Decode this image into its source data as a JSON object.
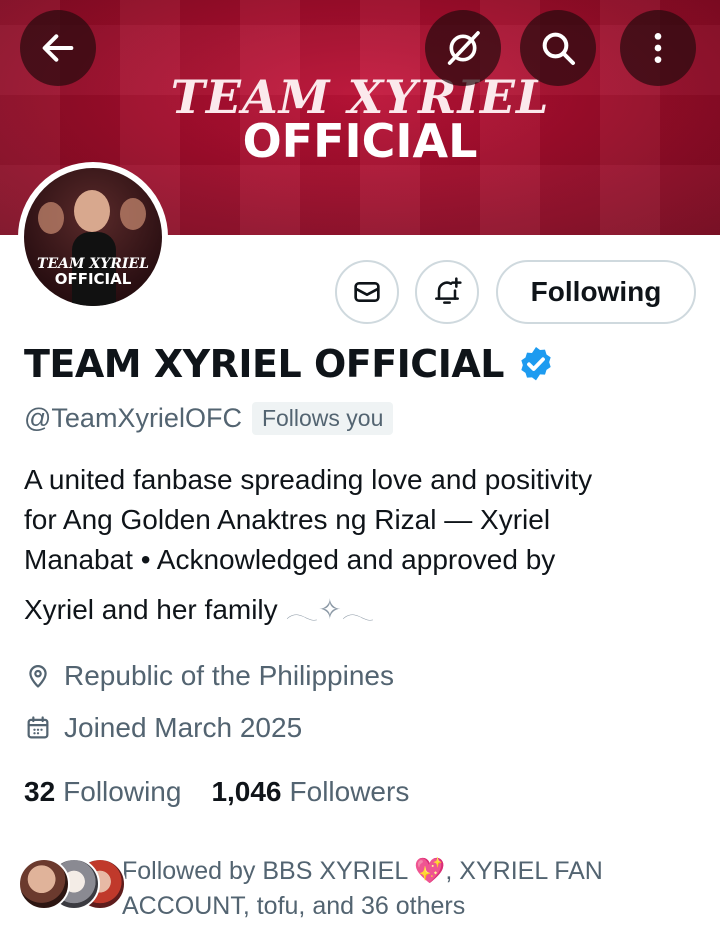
{
  "banner": {
    "title": "TEAM XYRIEL",
    "subtitle": "OFFICIAL"
  },
  "header_buttons": {
    "back_icon": "arrow-left-icon",
    "grok_icon": "grok-icon",
    "search_icon": "search-icon",
    "more_icon": "more-vertical-icon"
  },
  "avatar": {
    "line1": "TEAM XYRIEL",
    "line2": "OFFICIAL"
  },
  "actions": {
    "message_icon": "mail-icon",
    "notify_icon": "bell-plus-icon",
    "following_label": "Following"
  },
  "profile": {
    "display_name": "TEAM XYRIEL OFFICIAL",
    "handle": "@TeamXyrielOFC",
    "follows_you": "Follows you",
    "bio_line1": "A united fanbase spreading love and positivity",
    "bio_line2": "for Ang Golden Anaktres ng Rizal — Xyriel",
    "bio_line3": "Manabat  • Acknowledged and approved by",
    "bio_line4": "Xyriel and her family",
    "bio_wings": "𓂃✧𓂃",
    "location": "Republic of the Philippines",
    "joined": "Joined March 2025",
    "verified_color": "#1d9bf0"
  },
  "counts": {
    "following_num": "32",
    "following_label": "Following",
    "followers_num": "1,046",
    "followers_label": "Followers"
  },
  "followed_by": {
    "prefix": "Followed by BBS XYRIEL ",
    "heart": "💖",
    "rest": ", XYRIEL FAN ACCOUNT, tofu, and 36 others"
  }
}
